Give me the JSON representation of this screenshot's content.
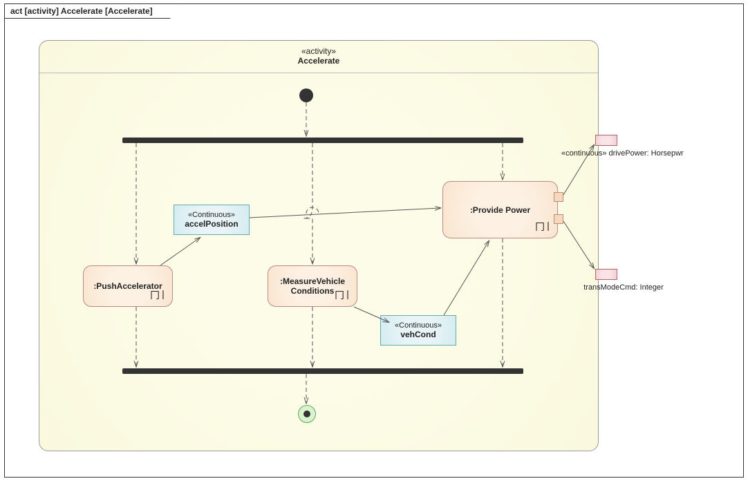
{
  "frame": {
    "label": "act [activity] Accelerate [Accelerate]"
  },
  "activity": {
    "stereotype": "«activity»",
    "name": "Accelerate"
  },
  "nodes": {
    "push": {
      "label": ":PushAccelerator"
    },
    "measure": {
      "label": ":MeasureVehicle Conditions"
    },
    "provide": {
      "label": ":Provide Power"
    }
  },
  "dataNodes": {
    "accel": {
      "stereotype": "«Continuous»",
      "name": "accelPosition"
    },
    "vehCond": {
      "stereotype": "«Continuous»",
      "name": "vehCond"
    }
  },
  "params": {
    "drivePower": {
      "label": "«continuous» drivePower: Horsepwr"
    },
    "transMode": {
      "label": "transModeCmd: Integer"
    }
  },
  "rake": "⌕"
}
